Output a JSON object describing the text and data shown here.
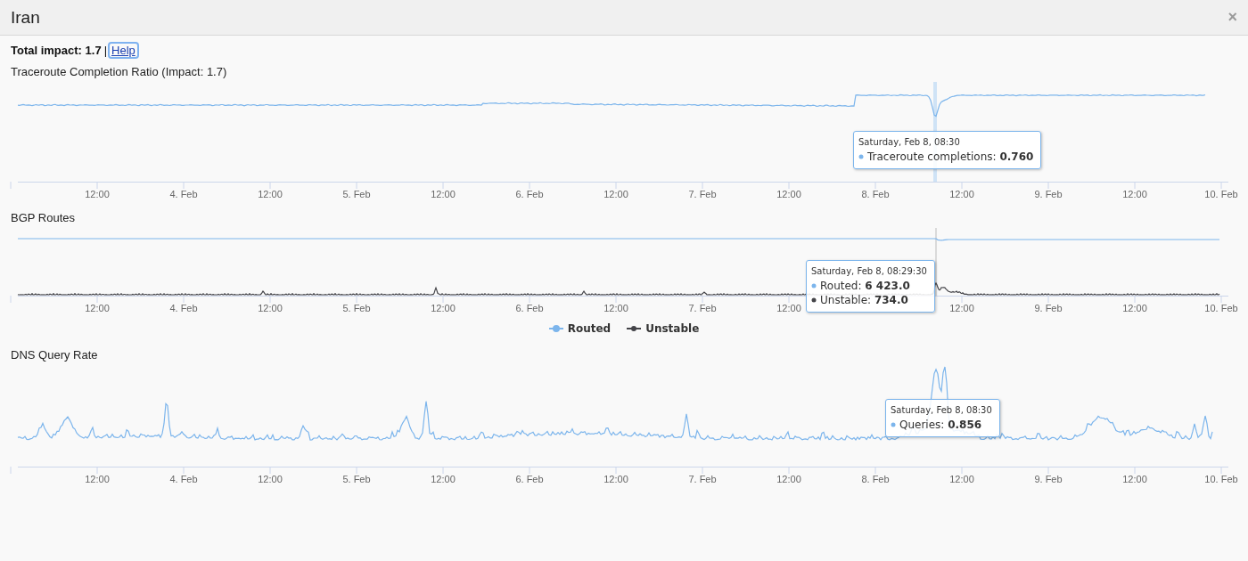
{
  "window": {
    "title": "Iran",
    "close": "×"
  },
  "summary": {
    "label": "Total impact: 1.7",
    "separator": "|",
    "help_link": "Help"
  },
  "charts": [
    {
      "title": "Traceroute Completion Ratio (Impact: 1.7)",
      "x_labels": [
        "12:00",
        "4. Feb",
        "12:00",
        "5. Feb",
        "12:00",
        "6. Feb",
        "12:00",
        "7. Feb",
        "12:00",
        "8. Feb",
        "12:00",
        "9. Feb",
        "12:00",
        "10. Feb"
      ],
      "series": [
        {
          "kind": "completion"
        }
      ],
      "tooltip": {
        "time": "Saturday, Feb 8, 08:30",
        "rows": [
          {
            "label": "Traceroute completions:",
            "value": "0.760",
            "color": "#7cb5ec"
          }
        ]
      }
    },
    {
      "title": "BGP Routes",
      "x_labels": [
        "12:00",
        "4. Feb",
        "12:00",
        "5. Feb",
        "12:00",
        "6. Feb",
        "12:00",
        "7. Feb",
        "12:00",
        "12:00",
        "9. Feb",
        "12:00",
        "10. Feb"
      ],
      "series": [
        {
          "kind": "flat"
        },
        {
          "kind": "spikes"
        }
      ],
      "tooltip": {
        "time": "Saturday, Feb 8, 08:29:30",
        "rows": [
          {
            "label": "Routed:",
            "value": "6 423.0",
            "color": "#7cb5ec"
          },
          {
            "label": "Unstable:",
            "value": "734.0",
            "color": "#434348"
          }
        ]
      },
      "legend": [
        {
          "label": "Routed",
          "color": "#7cb5ec"
        },
        {
          "label": "Unstable",
          "color": "#434348"
        }
      ]
    },
    {
      "title": "DNS Query Rate",
      "x_labels": [
        "12:00",
        "4. Feb",
        "12:00",
        "5. Feb",
        "12:00",
        "6. Feb",
        "12:00",
        "7. Feb",
        "12:00",
        "8. Feb",
        "12:00",
        "9. Feb",
        "12:00",
        "10. Feb"
      ],
      "series": [
        {
          "kind": "noisy"
        }
      ],
      "tooltip": {
        "time": "Saturday, Feb 8, 08:30",
        "rows": [
          {
            "label": "Queries:",
            "value": "0.856",
            "color": "#7cb5ec"
          }
        ]
      }
    }
  ]
}
